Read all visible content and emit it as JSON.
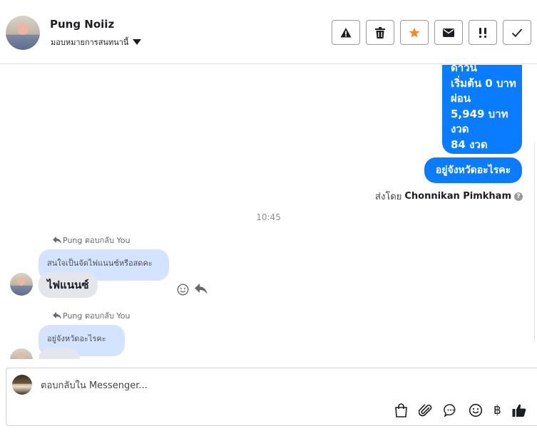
{
  "header": {
    "name": "Pung Noiiz",
    "assign_label": "มอบหมายการสนทนานี้"
  },
  "toolbar": {
    "buttons": [
      "alert",
      "delete",
      "star",
      "mail",
      "important",
      "done"
    ],
    "star_color": "#f5882c"
  },
  "messages": {
    "outgoing_lines": [
      "ดาวน์",
      "เริ่มต้น 0 บาท",
      "ผ่อน",
      "5,949 บาท",
      "งวด",
      "84 งวด"
    ],
    "outgoing_2": "อยู่จังหวัดอะไรคะ",
    "sent_by_label": "ส่งโดย",
    "sent_by_name": "Chonnikan Pimkham",
    "help_mark": "?",
    "timestamp": "10:45",
    "reply1": {
      "header": "Pung ตอบกลับ You",
      "quote": "สนใจเป็นจัดไฟแนนซ์หรือสดคะ",
      "text": "ไฟแนนซ์"
    },
    "reply2": {
      "header": "Pung ตอบกลับ You",
      "quote": "อยู่จังหวัดอะไรคะ",
      "text": ""
    },
    "accent_color": "#0a7cff"
  },
  "composer": {
    "placeholder": "ตอบกลับใน Messenger...",
    "baht_symbol": "฿"
  }
}
